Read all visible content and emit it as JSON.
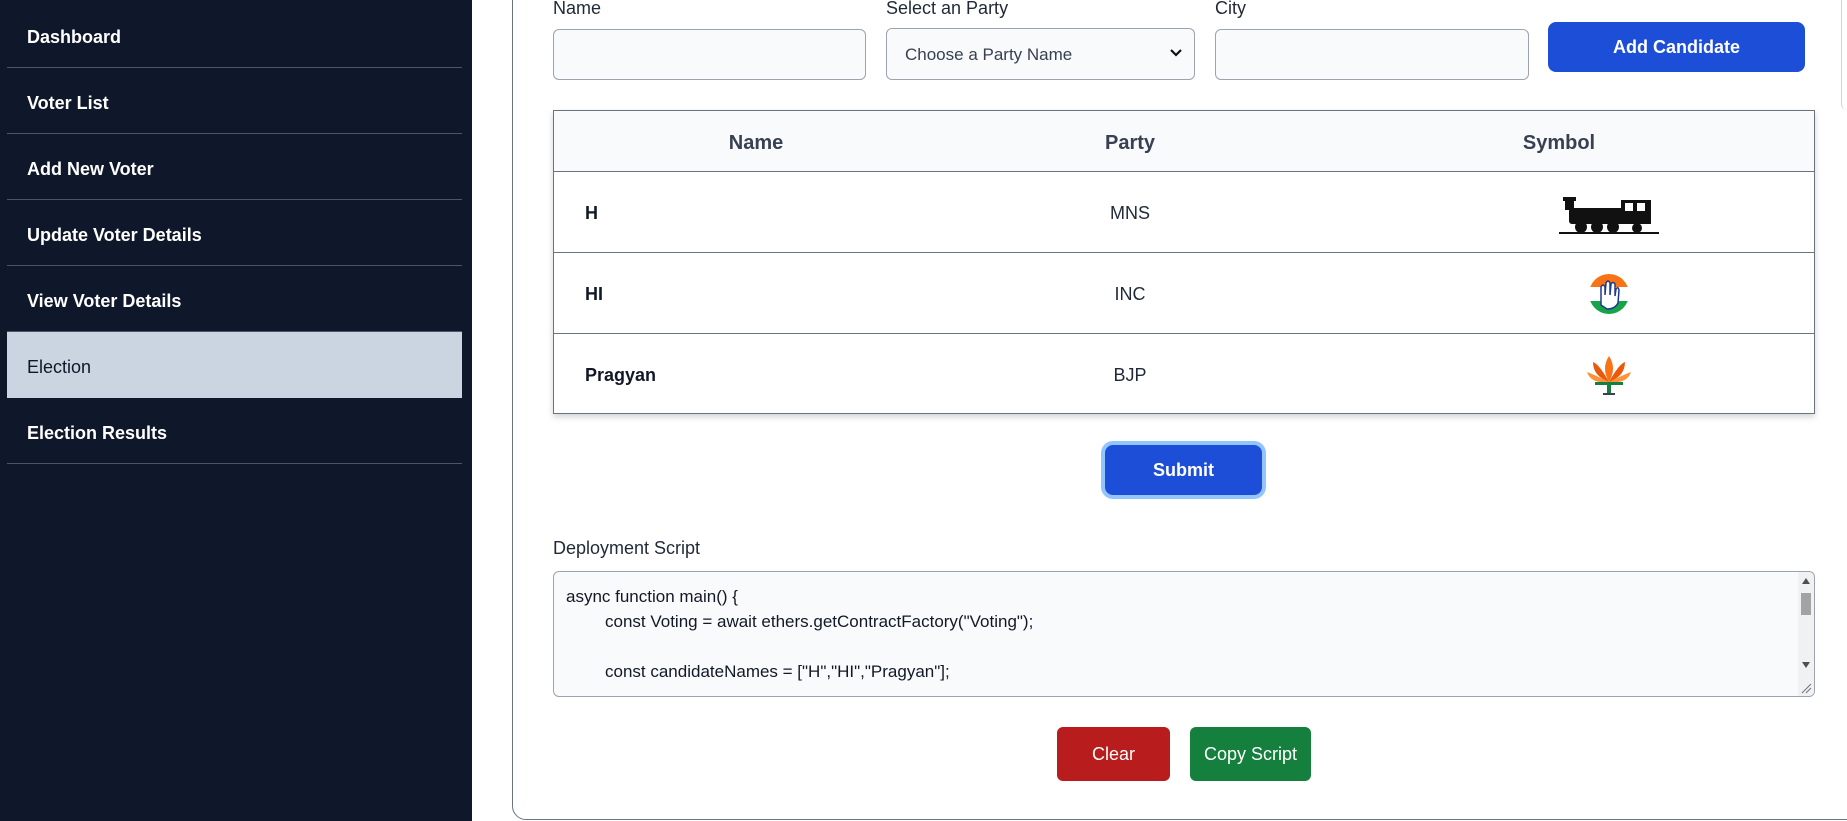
{
  "sidebar": {
    "items": [
      {
        "label": "Dashboard"
      },
      {
        "label": "Voter List"
      },
      {
        "label": "Add New Voter"
      },
      {
        "label": "Update Voter Details"
      },
      {
        "label": "View Voter Details"
      },
      {
        "label": "Election",
        "active": true
      },
      {
        "label": "Election Results"
      }
    ]
  },
  "form": {
    "name_label": "Name",
    "party_label": "Select an Party",
    "party_placeholder": "Choose a Party Name",
    "city_label": "City",
    "add_button": "Add Candidate"
  },
  "table": {
    "headers": [
      "Name",
      "Party",
      "Symbol"
    ],
    "rows": [
      {
        "name": "H",
        "party": "MNS",
        "symbol": "railway-engine-icon"
      },
      {
        "name": "HI",
        "party": "INC",
        "symbol": "hand-icon"
      },
      {
        "name": "Pragyan",
        "party": "BJP",
        "symbol": "lotus-icon"
      }
    ]
  },
  "submit_button": "Submit",
  "script": {
    "label": "Deployment Script",
    "lines": [
      "async function main() {",
      "const Voting = await ethers.getContractFactory(\"Voting\");",
      "",
      "const candidateNames = [\"H\",\"HI\",\"Pragyan\"];"
    ]
  },
  "actions": {
    "clear": "Clear",
    "copy": "Copy Script"
  },
  "colors": {
    "sidebar_bg": "#0f172a",
    "active_item_bg": "#cbd5e1",
    "primary_blue": "#1d4ed8",
    "danger_red": "#b91c1c",
    "success_green": "#15803d"
  }
}
